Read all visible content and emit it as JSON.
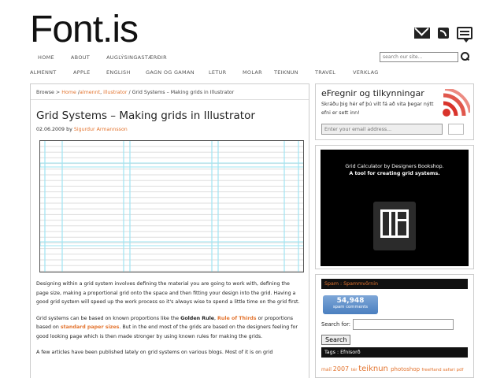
{
  "site": {
    "logo": "Font.is"
  },
  "header": {
    "nav_primary": [
      "HOME",
      "ABOUT",
      "AUGLÝSINGASTÆRÐIR"
    ],
    "search_placeholder": "search our site...",
    "nav_categories": [
      "ALMENNT",
      "APPLE",
      "ENGLISH",
      "GAGN OG GAMAN",
      "LETUR",
      "MOLAR",
      "TEIKNUN",
      "TRAVEL",
      "VERKLAG"
    ]
  },
  "breadcrumb": {
    "prefix": "Browse >",
    "home": "Home",
    "sep1": "/",
    "cat1": "almennt",
    "comma": ",",
    "cat2": "illustrator",
    "sep2": "/",
    "current": "Grid Systems – Making grids in Illustrator"
  },
  "post": {
    "title": "Grid Systems – Making grids in Illustrator",
    "date": "02.06.2009",
    "by": "by",
    "author": "Sigurdur Armannsson",
    "p1": "Designing within a grid system involves defining the material you are going to work with, defining the page size, making a proportional grid onto the space and then fitting your design into the grid. Having a good grid system will speed up the work process so it's always wise to spend a little time on the grid first.",
    "p2_a": "Grid systems can be based on known proportions like the ",
    "p2_b1": "Golden Rule",
    "p2_c": ", ",
    "p2_l1": "Rule of Thirds",
    "p2_d": " or proportions based on ",
    "p2_l2": "standard paper sizes",
    "p2_e": ". But in the end most of the grids are based on the designers feeling for good looking page which is then made stronger by using known rules for making the grids.",
    "p3": "A few articles have been published lately on grid systems on various blogs. Most of it is on grid"
  },
  "sidebar": {
    "newsletter": {
      "title": "eFregnir og tilkynningar",
      "desc": "Skráðu þig hér ef þú vilt fá að vita þegar nýtt efni er sett inn!",
      "email_placeholder": "Enter your email address..."
    },
    "ad": {
      "line1": "Grid Calculator by Designers Bookshop.",
      "line2": "A tool for creating grid systems."
    },
    "spam": {
      "heading": "Spam : Spammvörnin",
      "count": "54,948",
      "count_label": "spam comments",
      "search_label": "Search for:",
      "search_button": "Search",
      "tags_heading": "Tags : Efnisorð"
    },
    "tags": [
      {
        "label": "mail",
        "size": 6
      },
      {
        "label": "2007",
        "size": 8
      },
      {
        "label": "tér",
        "size": 5.5
      },
      {
        "label": "teiknun",
        "size": 10
      },
      {
        "label": "photoshop",
        "size": 7
      },
      {
        "label": "freeHand",
        "size": 5.5
      },
      {
        "label": "safari",
        "size": 5.5
      },
      {
        "label": "pdf",
        "size": 5.5
      }
    ]
  },
  "colors": {
    "accent": "#e3742f",
    "grid_line": "#9fe4f2",
    "bar_bg": "#111111"
  },
  "icons": [
    "mail-icon",
    "rss-icon",
    "comment-icon",
    "search-icon",
    "rss-large-icon",
    "grid-calculator-logo-icon"
  ]
}
